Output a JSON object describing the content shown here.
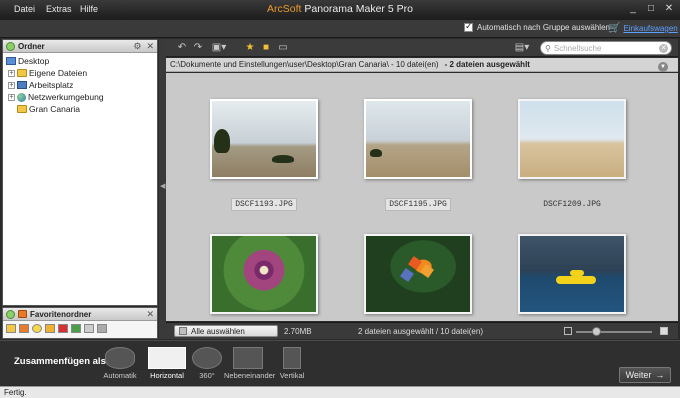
{
  "menu": {
    "items": [
      "Datei",
      "Extras",
      "Hilfe"
    ]
  },
  "app": {
    "brand": "ArcSoft",
    "title": "Panorama Maker 5 Pro"
  },
  "window": {
    "minimize": "_",
    "maximize": "□",
    "close": "✕"
  },
  "top": {
    "auto_group_label": "Automatisch nach Gruppe auswählen",
    "cart_label": "Einkaufswagen"
  },
  "folders": {
    "title": "Ordner",
    "tree": [
      "Desktop",
      "Eigene Dateien",
      "Arbeitsplatz",
      "Netzwerkumgebung",
      "Gran Canaria"
    ]
  },
  "favorites": {
    "title": "Favoritenordner"
  },
  "search": {
    "placeholder": "Schnellsuche"
  },
  "path": {
    "text": "C:\\Dokumente und Einstellungen\\user\\Desktop\\Gran Canaria\\ - 10 datei(en)",
    "selection": "- 2 dateien ausgewählt"
  },
  "photos": [
    {
      "name": "DSCF1193.JPG",
      "selected": true
    },
    {
      "name": "DSCF1195.JPG",
      "selected": true
    },
    {
      "name": "DSCF1209.JPG",
      "selected": false
    },
    {
      "name": "",
      "selected": false
    },
    {
      "name": "",
      "selected": false
    },
    {
      "name": "",
      "selected": false
    }
  ],
  "footer": {
    "select_all": "Alle auswählen",
    "size": "2.70MB",
    "status": "2 dateien ausgewählt / 10 datei(en)"
  },
  "merge": {
    "label": "Zusammenfügen als:",
    "modes": [
      "Automatik",
      "Horizontal",
      "360°",
      "Nebeneinander",
      "Vertikal"
    ],
    "active": "Horizontal",
    "next": "Weiter"
  },
  "status": {
    "text": "Fertig."
  }
}
